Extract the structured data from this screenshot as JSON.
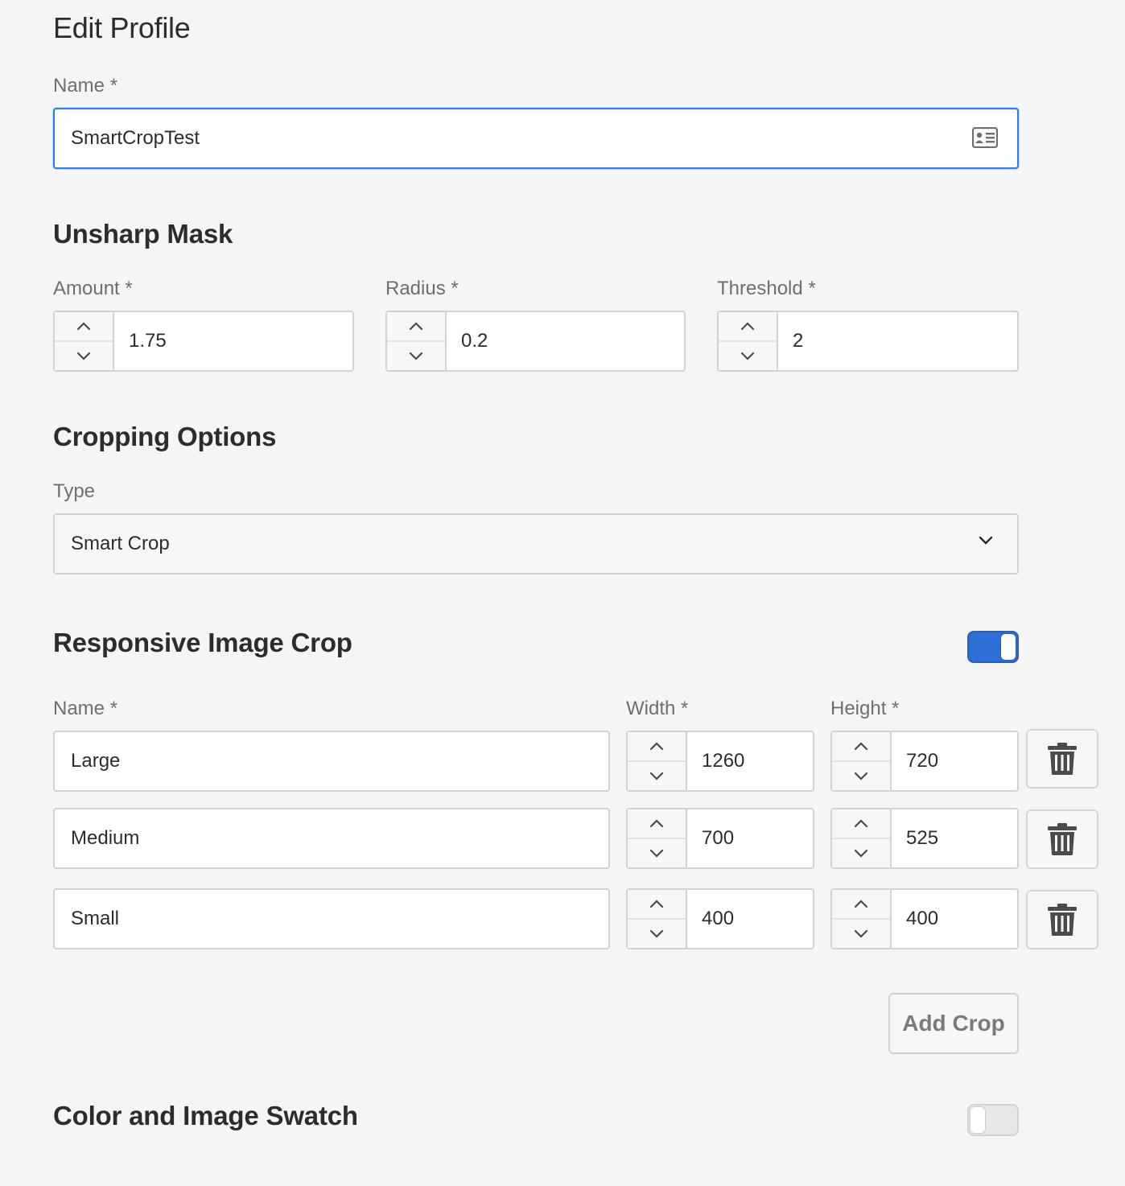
{
  "page": {
    "title": "Edit Profile"
  },
  "name_field": {
    "label": "Name *",
    "value": "SmartCropTest",
    "icon": "profile-card-icon"
  },
  "unsharp_mask": {
    "title": "Unsharp Mask",
    "amount": {
      "label": "Amount *",
      "value": "1.75"
    },
    "radius": {
      "label": "Radius *",
      "value": "0.2"
    },
    "threshold": {
      "label": "Threshold *",
      "value": "2"
    }
  },
  "cropping_options": {
    "title": "Cropping Options",
    "type_label": "Type",
    "type_value": "Smart Crop"
  },
  "responsive_crop": {
    "title": "Responsive Image Crop",
    "enabled": true,
    "headers": {
      "name": "Name *",
      "width": "Width *",
      "height": "Height *"
    },
    "rows": [
      {
        "name": "Large",
        "width": "1260",
        "height": "720"
      },
      {
        "name": "Medium",
        "width": "700",
        "height": "525"
      },
      {
        "name": "Small",
        "width": "400",
        "height": "400"
      }
    ],
    "add_label": "Add Crop"
  },
  "swatch": {
    "title": "Color and Image Swatch",
    "enabled": false
  },
  "colors": {
    "accent": "#2680eb",
    "toggle_on": "#2d6fd6"
  }
}
